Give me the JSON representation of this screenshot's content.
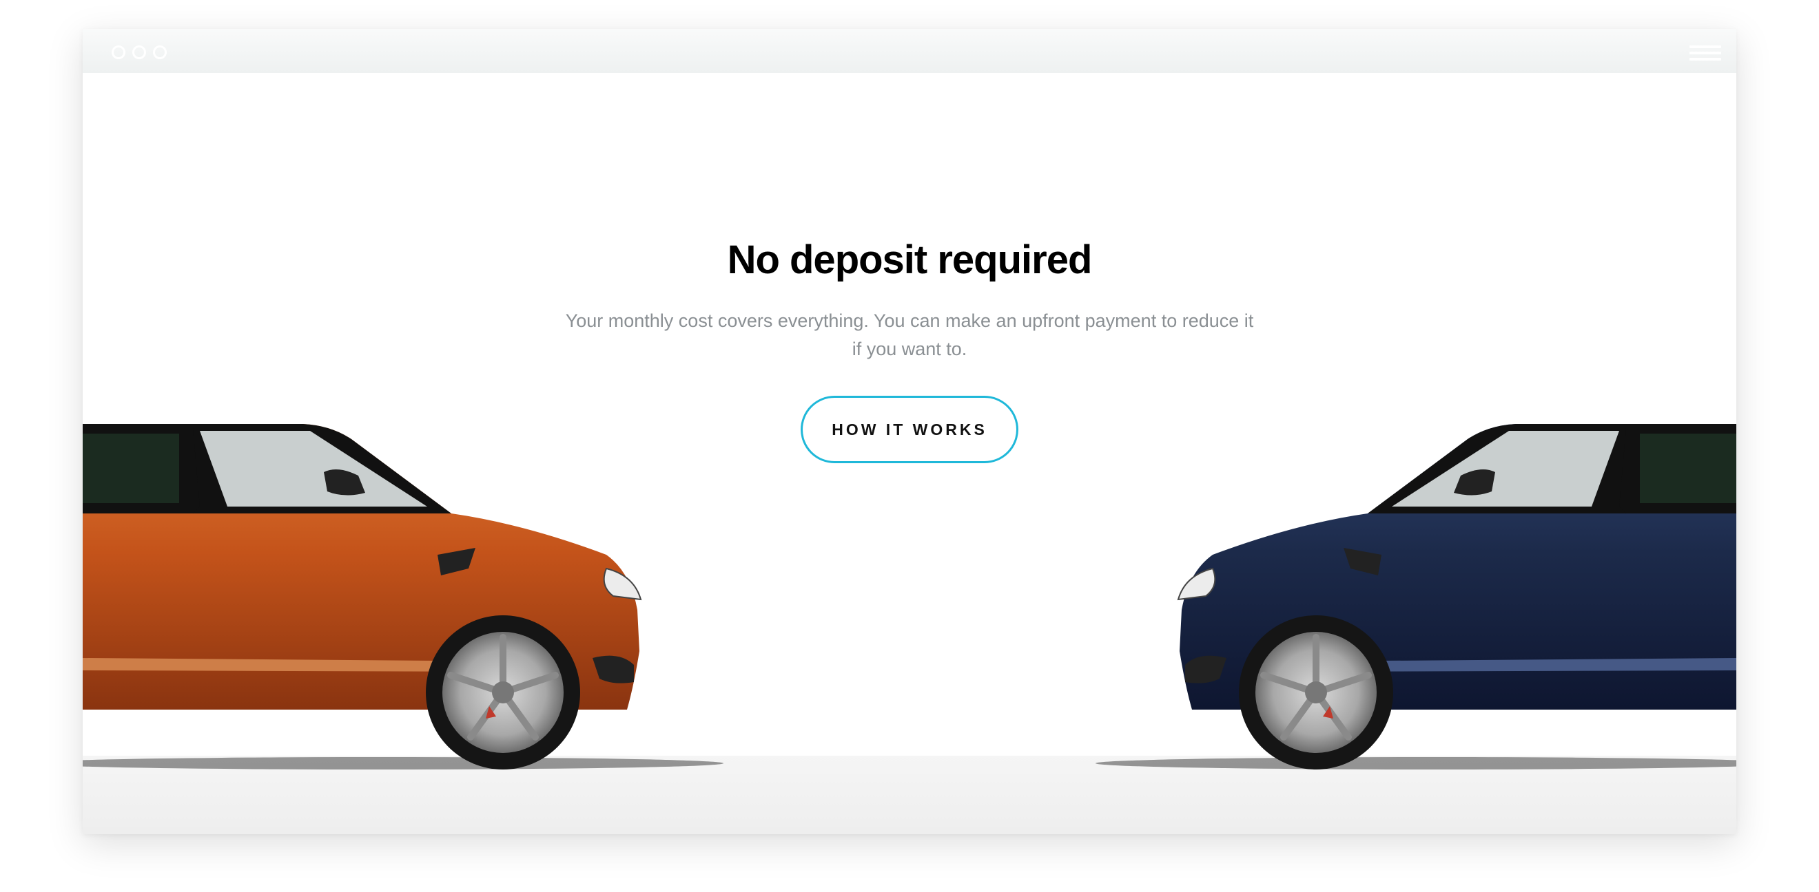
{
  "hero": {
    "title": "No deposit required",
    "subtitle": "Your monthly cost covers everything. You can make an upfront payment to reduce it if you want to.",
    "cta_label": "HOW IT WORKS"
  },
  "colors": {
    "accent": "#1fb8d9",
    "title_text": "#000000",
    "subtitle_text": "#8a8f93",
    "left_car_body": "#c4531a",
    "right_car_body": "#1c2a4a"
  },
  "icons": {
    "window_controls": "three-circle-dots",
    "menu": "hamburger-menu-icon"
  }
}
